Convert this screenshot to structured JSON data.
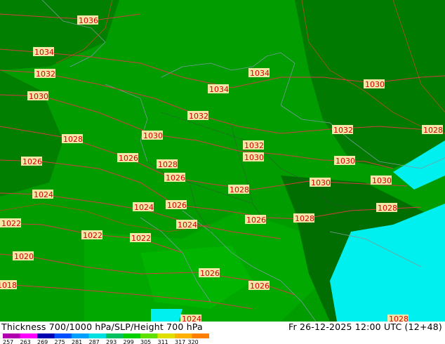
{
  "title": "Thickness 700/1000 hPa/SLP/Height 700 hPa",
  "valid_time": "Fr 26-12-2025 12:00 UTC (12+48)",
  "isobars": [
    "1036",
    "1034",
    "1032",
    "1030",
    "1034",
    "1034",
    "1030",
    "1028",
    "1030",
    "1032",
    "1032",
    "1028",
    "1026",
    "1026",
    "1028",
    "1032",
    "1030",
    "1030",
    "1030",
    "1026",
    "1024",
    "1026",
    "1028",
    "1030",
    "1024",
    "1026",
    "1028",
    "1022",
    "1022",
    "1024",
    "1028",
    "1022",
    "1020",
    "1026",
    "1018",
    "1026",
    "1024",
    "1028"
  ],
  "colorbar": {
    "ticks": [
      "257",
      "263",
      "269",
      "275",
      "281",
      "287",
      "293",
      "299",
      "305",
      "311",
      "317",
      "320"
    ],
    "colors": [
      "#b000b0",
      "#ff00ff",
      "#0000b0",
      "#0050ff",
      "#00a0ff",
      "#00e0e0",
      "#00c060",
      "#00d000",
      "#60e000",
      "#e0e000",
      "#ffb000",
      "#ff8000"
    ]
  },
  "colors": {
    "deep_green": "#007a00",
    "mid_green": "#009900",
    "light_green": "#00b000",
    "cyan": "#00f0f0",
    "isoline": "#d04040"
  }
}
